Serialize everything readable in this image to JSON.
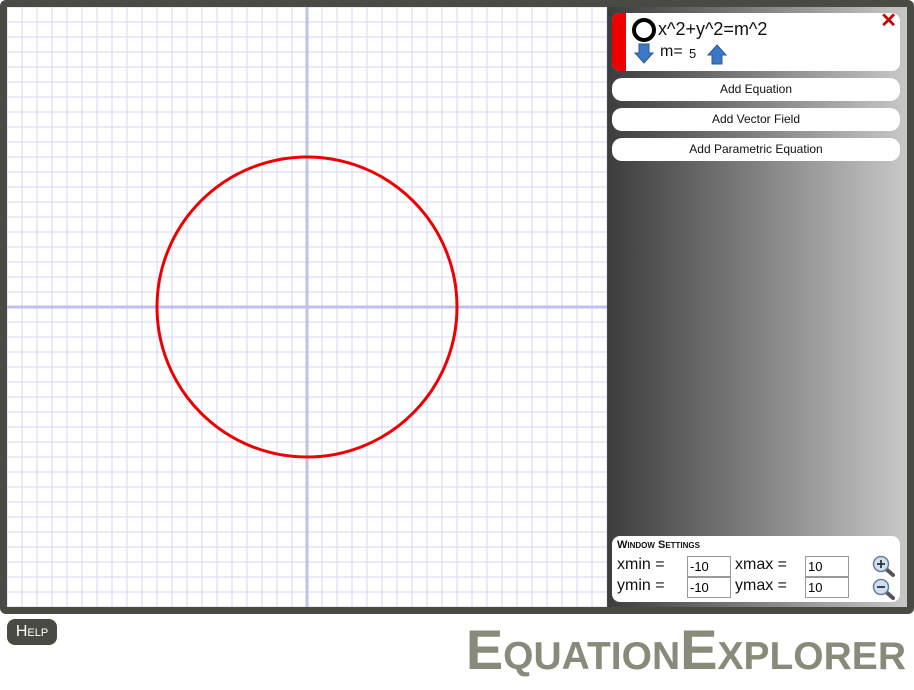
{
  "equation": {
    "text": "x^2+y^2=m^2",
    "color": "#ee0000",
    "param_label": "m=",
    "param_value": "5",
    "close_symbol": "✕"
  },
  "buttons": {
    "add_equation": "Add Equation",
    "add_vector_field": "Add Vector Field",
    "add_parametric": "Add Parametric Equation"
  },
  "window_settings": {
    "title": "Window Settings",
    "xmin_label": "xmin =",
    "xmax_label": "xmax =",
    "ymin_label": "ymin =",
    "ymax_label": "ymax =",
    "xmin": "-10",
    "xmax": "10",
    "ymin": "-10",
    "ymax": "10"
  },
  "help_label": "Help",
  "app_title": "EquationExplorer",
  "icons": {
    "visibility": "ring-icon",
    "decrement": "arrow-down-icon",
    "increment": "arrow-up-icon",
    "close": "close-icon",
    "zoom_in": "zoom-in-icon",
    "zoom_out": "zoom-out-icon"
  },
  "colors": {
    "frame": "#4a4a44",
    "grid": "#d6d6f4",
    "axes": "#c0c0ee",
    "curve": "#ee0000"
  }
}
